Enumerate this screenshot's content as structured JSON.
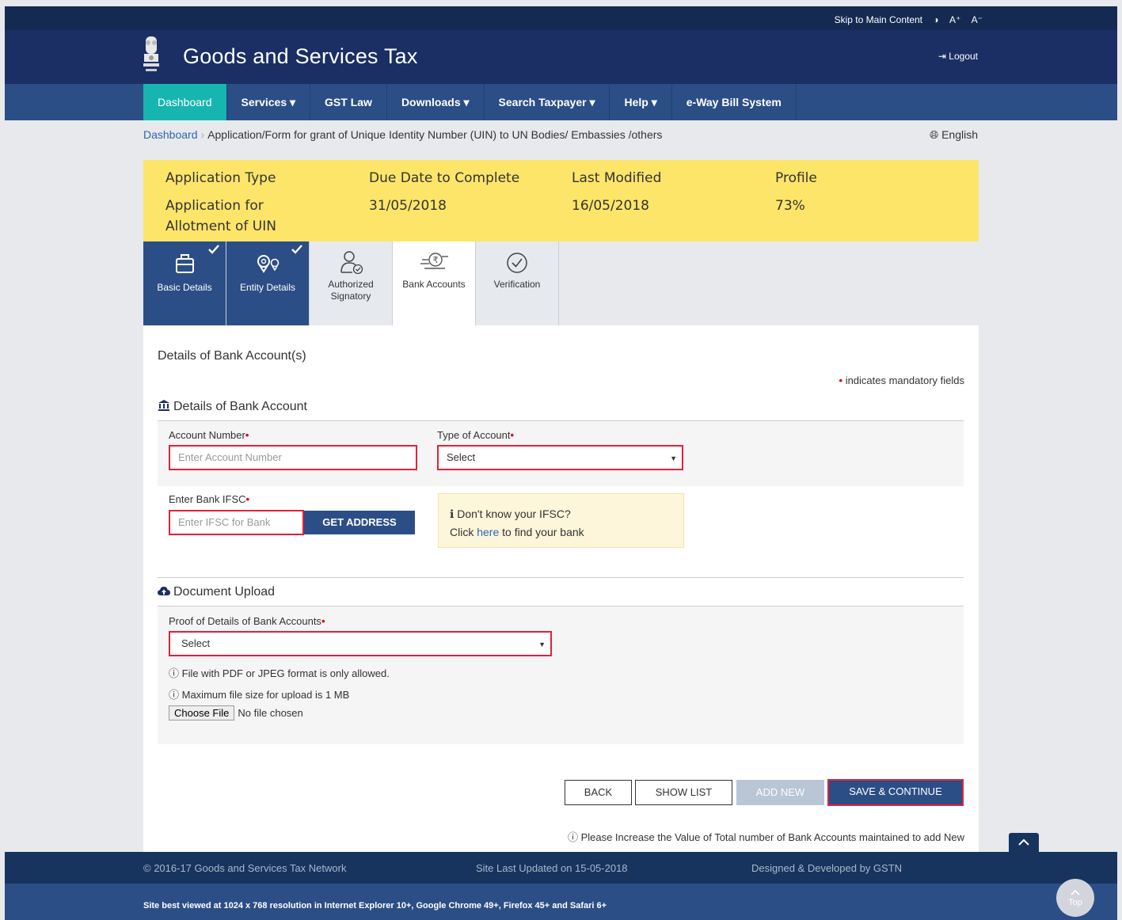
{
  "topbar": {
    "skip": "Skip to Main Content",
    "contrast": "◑",
    "font_up": "A⁺",
    "font_down": "A⁻"
  },
  "header": {
    "title": "Goods and Services Tax",
    "logout": "Logout"
  },
  "nav": {
    "items": [
      "Dashboard",
      "Services ▾",
      "GST Law",
      "Downloads ▾",
      "Search Taxpayer ▾",
      "Help ▾",
      "e-Way Bill System"
    ]
  },
  "breadcrumb": {
    "home": "Dashboard",
    "current": "Application/Form for grant of Unique Identity Number (UIN) to UN Bodies/ Embassies /others"
  },
  "language": "English",
  "summary": {
    "app_type_label": "Application Type",
    "app_type_value_1": "Application for",
    "app_type_value_2": "Allotment of UIN",
    "due_label": "Due Date to Complete",
    "due_value": "31/05/2018",
    "modified_label": "Last Modified",
    "modified_value": "16/05/2018",
    "profile_label": "Profile",
    "profile_value": "73%"
  },
  "tabs": {
    "basic": "Basic Details",
    "entity": "Entity Details",
    "auth_1": "Authorized",
    "auth_2": "Signatory",
    "bank": "Bank Accounts",
    "verify": "Verification"
  },
  "form": {
    "page_title": "Details of Bank Account(s)",
    "mandatory_note": "indicates mandatory fields",
    "section_bank": "Details of Bank Account",
    "account_label": "Account Number",
    "account_placeholder": "Enter Account Number",
    "type_label": "Type of Account",
    "type_value": "Select",
    "ifsc_label": "Enter Bank IFSC",
    "ifsc_placeholder": "Enter IFSC for Bank",
    "get_address": "GET ADDRESS",
    "ifsc_help_title": "Don't know your IFSC?",
    "ifsc_help_click": "Click",
    "ifsc_help_link": "here",
    "ifsc_help_rest": "to find your bank",
    "section_doc": "Document Upload",
    "proof_label": "Proof of Details of Bank Accounts",
    "proof_value": "Select",
    "note_format": "File with PDF or JPEG format is only allowed.",
    "note_size": "Maximum file size for upload is 1 MB",
    "choose_file": "Choose File",
    "no_file": "No file chosen"
  },
  "buttons": {
    "back": "BACK",
    "show_list": "SHOW LIST",
    "add_new": "ADD NEW",
    "save": "SAVE & CONTINUE"
  },
  "bottom_note": "Please Increase the Value of Total number of Bank Accounts maintained to add New",
  "footer": {
    "copyright": "© 2016-17 Goods and Services Tax Network",
    "updated": "Site Last Updated on 15-05-2018",
    "designed": "Designed & Developed by GSTN",
    "browsers": "Site best viewed at 1024 x 768 resolution in Internet Explorer 10+, Google Chrome 49+, Firefox 45+ and Safari 6+",
    "top": "Top"
  },
  "colors": {
    "navy": "#1b2f64",
    "nav": "#2c4e86",
    "teal": "#17b5b0",
    "yellow": "#fde56a",
    "required": "#e0002a"
  }
}
